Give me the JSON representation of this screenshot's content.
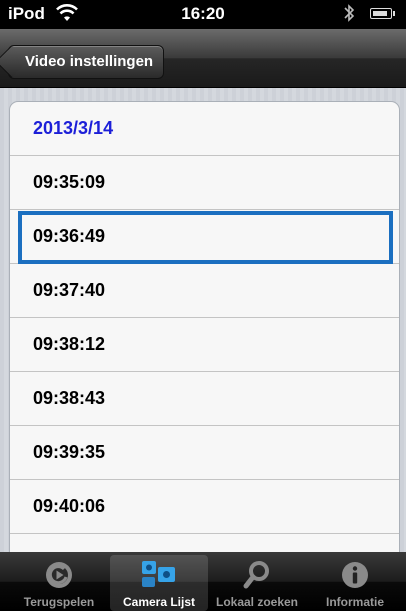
{
  "status_bar": {
    "carrier": "iPod",
    "time": "16:20",
    "wifi_icon": "wifi-icon",
    "bluetooth_icon": "bluetooth-icon",
    "battery_icon": "battery-icon"
  },
  "nav": {
    "back_label": "Video instellingen"
  },
  "list": {
    "date": "2013/3/14",
    "items": [
      "09:35:09",
      "09:36:49",
      "09:37:40",
      "09:38:12",
      "09:38:43",
      "09:39:35",
      "09:40:06"
    ],
    "selected": "09:36:49"
  },
  "tabbar": {
    "tabs": [
      {
        "label": "Terugspelen",
        "icon": "playback-icon"
      },
      {
        "label": "Camera Lijst",
        "icon": "camera-list-icon",
        "active": true
      },
      {
        "label": "Lokaal zoeken",
        "icon": "search-icon"
      },
      {
        "label": "Informatie",
        "icon": "info-icon"
      }
    ]
  },
  "colors": {
    "date_text": "#1c1fd8",
    "selection_border": "#1b6fc0"
  }
}
